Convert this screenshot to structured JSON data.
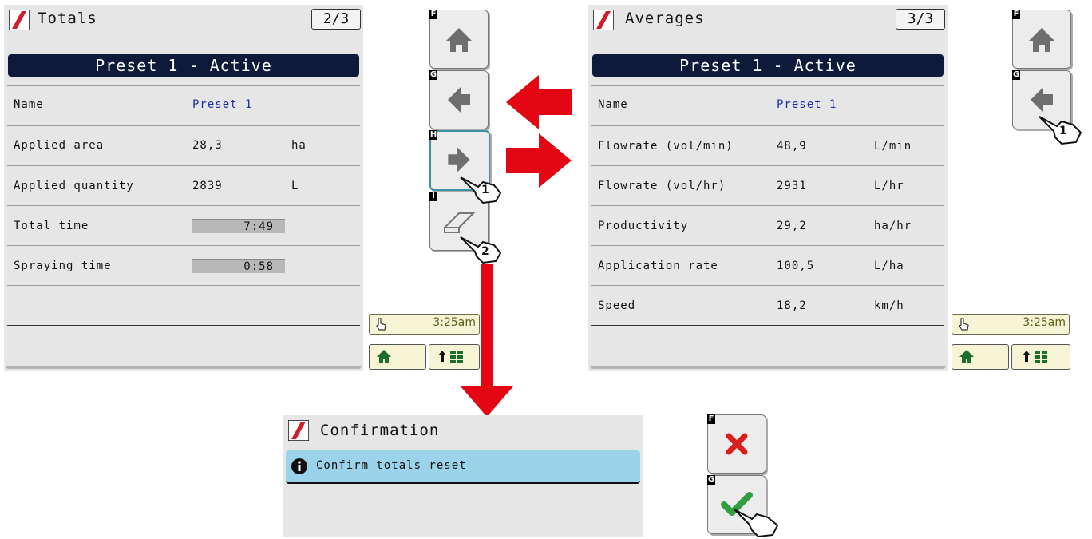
{
  "totals_screen": {
    "title": "Totals",
    "page": "2/3",
    "banner": "Preset 1 - Active",
    "rows": [
      {
        "label": "Name",
        "value": "Preset 1",
        "unit": ""
      },
      {
        "label": "Applied area",
        "value": "28,3",
        "unit": "ha"
      },
      {
        "label": "Applied quantity",
        "value": "2839",
        "unit": "L"
      },
      {
        "label": "Total time",
        "value": "7:49",
        "unit": ""
      },
      {
        "label": "Spraying time",
        "value": "0:58",
        "unit": ""
      }
    ],
    "keys": {
      "f": "F",
      "g": "G",
      "h": "H",
      "i": "I"
    },
    "status_time": "3:25am"
  },
  "averages_screen": {
    "title": "Averages",
    "page": "3/3",
    "banner": "Preset 1 - Active",
    "rows": [
      {
        "label": "Name",
        "value": "Preset 1",
        "unit": ""
      },
      {
        "label": "Flowrate (vol/min)",
        "value": "48,9",
        "unit": "L/min"
      },
      {
        "label": "Flowrate (vol/hr)",
        "value": "2931",
        "unit": "L/hr"
      },
      {
        "label": "Productivity",
        "value": "29,2",
        "unit": "ha/hr"
      },
      {
        "label": "Application rate",
        "value": "100,5",
        "unit": "L/ha"
      },
      {
        "label": "Speed",
        "value": "18,2",
        "unit": "km/h"
      }
    ],
    "keys": {
      "f": "F",
      "g": "G"
    },
    "status_time": "3:25am"
  },
  "confirmation_screen": {
    "title": "Confirmation",
    "message": "Confirm totals reset",
    "keys": {
      "f": "F",
      "g": "G"
    }
  },
  "callouts": {
    "one": "1",
    "two": "2"
  },
  "colors": {
    "banner": "#0d1a3a",
    "arrow": "#e30613",
    "info": "#9bd3ea",
    "link_value": "#1a2ea8",
    "confirm": "#2e9e3e",
    "cancel": "#d81e1e"
  }
}
